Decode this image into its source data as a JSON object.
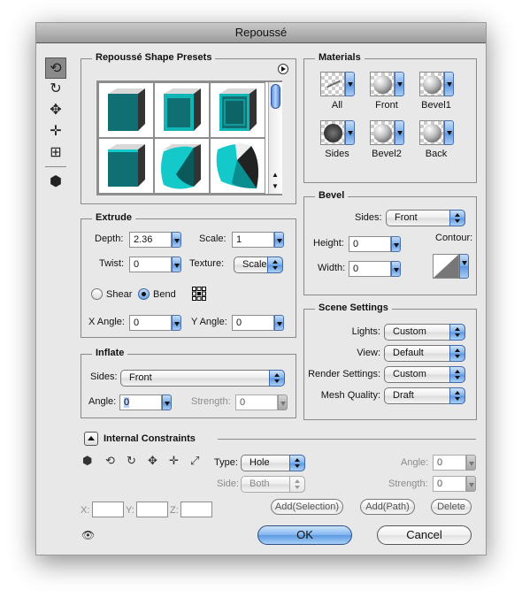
{
  "window": {
    "title": "Repoussé"
  },
  "toolbar": {
    "tools": [
      {
        "name": "object-rotate-tool",
        "selected": true
      },
      {
        "name": "object-roll-tool",
        "selected": false
      },
      {
        "name": "object-drag-tool",
        "selected": false
      },
      {
        "name": "object-slide-tool",
        "selected": false
      },
      {
        "name": "object-scale-tool",
        "selected": false
      },
      {
        "name": "camera-tool",
        "selected": false
      }
    ]
  },
  "presets": {
    "title": "Repoussé Shape Presets",
    "items": [
      "Extrude",
      "Bevel Frame",
      "Inflated Frame",
      "Bevel Extrude",
      "Inflate Sides",
      "Inflate Corner"
    ]
  },
  "materials": {
    "title": "Materials",
    "items": [
      {
        "label": "All",
        "type": "none"
      },
      {
        "label": "Front",
        "type": "ball"
      },
      {
        "label": "Bevel1",
        "type": "ball"
      },
      {
        "label": "Sides",
        "type": "texture"
      },
      {
        "label": "Bevel2",
        "type": "ball"
      },
      {
        "label": "Back",
        "type": "ball"
      }
    ]
  },
  "extrude": {
    "title": "Extrude",
    "depth_label": "Depth:",
    "depth": "2.36",
    "scale_label": "Scale:",
    "scale": "1",
    "twist_label": "Twist:",
    "twist": "0",
    "texture_label": "Texture:",
    "texture": "Scale",
    "shear_label": "Shear",
    "bend_label": "Bend",
    "mode": "Bend",
    "xangle_label": "X Angle:",
    "xangle": "0",
    "yangle_label": "Y Angle:",
    "yangle": "0"
  },
  "bevel": {
    "title": "Bevel",
    "sides_label": "Sides:",
    "sides": "Front",
    "height_label": "Height:",
    "height": "0",
    "width_label": "Width:",
    "width": "0",
    "contour_label": "Contour:"
  },
  "inflate": {
    "title": "Inflate",
    "sides_label": "Sides:",
    "sides": "Front",
    "angle_label": "Angle:",
    "angle": "0",
    "strength_label": "Strength:",
    "strength": "0"
  },
  "scene": {
    "title": "Scene Settings",
    "lights_label": "Lights:",
    "lights": "Custom",
    "view_label": "View:",
    "view": "Default",
    "render_label": "Render Settings:",
    "render": "Custom",
    "mesh_label": "Mesh Quality:",
    "mesh": "Draft"
  },
  "constraints": {
    "title": "Internal Constraints",
    "type_label": "Type:",
    "type": "Hole",
    "side_label": "Side:",
    "side": "Both",
    "angle_label": "Angle:",
    "angle": "0",
    "strength_label": "Strength:",
    "strength": "0",
    "x_label": "X:",
    "y_label": "Y:",
    "z_label": "Z:",
    "x": "",
    "y": "",
    "z": "",
    "add_selection": "Add(Selection)",
    "add_path": "Add(Path)",
    "delete": "Delete"
  },
  "footer": {
    "ok": "OK",
    "cancel": "Cancel"
  },
  "colors": {
    "accent": "#6aa3e6",
    "preset_teal": "#0f6f72",
    "preset_cyan": "#13c9c9"
  }
}
